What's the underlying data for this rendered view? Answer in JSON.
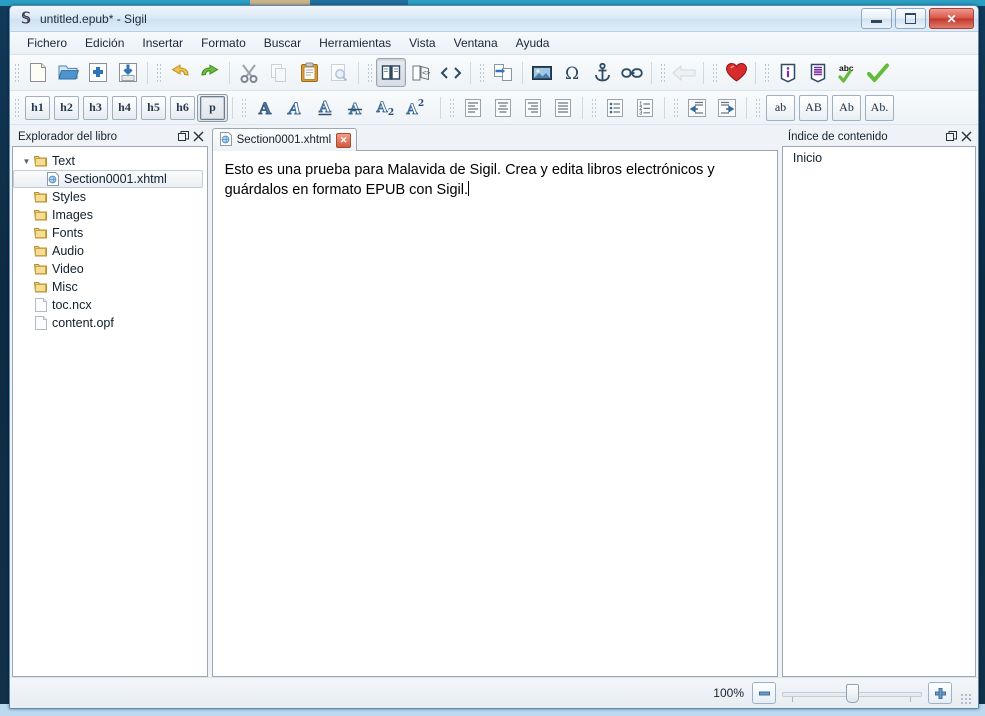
{
  "window": {
    "title": "untitled.epub* - Sigil",
    "app_icon": "sigil-s-icon",
    "minimize_label": "",
    "maximize_label": "",
    "close_label": "✕"
  },
  "menubar": {
    "items": [
      {
        "label": "Fichero",
        "name": "menu-fichero"
      },
      {
        "label": "Edición",
        "name": "menu-edicion"
      },
      {
        "label": "Insertar",
        "name": "menu-insertar"
      },
      {
        "label": "Formato",
        "name": "menu-formato"
      },
      {
        "label": "Buscar",
        "name": "menu-buscar"
      },
      {
        "label": "Herramientas",
        "name": "menu-herramientas"
      },
      {
        "label": "Vista",
        "name": "menu-vista"
      },
      {
        "label": "Ventana",
        "name": "menu-ventana"
      },
      {
        "label": "Ayuda",
        "name": "menu-ayuda"
      }
    ]
  },
  "toolbar_row1": {
    "groups": [
      [
        "new-file-icon",
        "open-folder-icon",
        "add-file-icon",
        "save-icon"
      ],
      [
        "undo-icon",
        "redo-icon"
      ],
      [
        "cut-scissors-icon",
        "copy-icon",
        "paste-clipboard-icon",
        "print-preview-icon"
      ],
      [
        "book-view-icon",
        "split-view-icon",
        "code-view-icon"
      ],
      [
        "split-section-icon"
      ],
      [
        "insert-image-icon",
        "insert-special-character-icon",
        "insert-anchor-icon",
        "insert-link-icon"
      ],
      [
        "back-arrow-icon"
      ],
      [
        "heart-donate-icon"
      ],
      [
        "metadata-info-icon",
        "generate-toc-icon",
        "spellcheck-icon",
        "validate-check-icon"
      ]
    ]
  },
  "toolbar_row2": {
    "headings": [
      "h1",
      "h2",
      "h3",
      "h4",
      "h5",
      "h6",
      "p"
    ],
    "selected_heading": "p",
    "format_icons": [
      "bold-icon",
      "italic-icon",
      "underline-icon",
      "strikethrough-icon",
      "subscript-icon",
      "superscript-icon"
    ],
    "align_icons": [
      "align-left-icon",
      "align-center-icon",
      "align-right-icon",
      "align-justify-icon"
    ],
    "list_icons": [
      "bullet-list-icon",
      "numbered-list-icon"
    ],
    "indent_icons": [
      "decrease-indent-icon",
      "increase-indent-icon"
    ],
    "case_buttons": [
      "ab",
      "AB",
      "Ab",
      "Ab."
    ]
  },
  "left_panel": {
    "title": "Explorador del libro",
    "float_icon": "undock-icon",
    "close_icon": "close-icon",
    "tree": [
      {
        "label": "Text",
        "type": "folder",
        "expanded": true,
        "indent": 0,
        "selected": false
      },
      {
        "label": "Section0001.xhtml",
        "type": "xhtml",
        "expanded": false,
        "indent": 1,
        "selected": true
      },
      {
        "label": "Styles",
        "type": "folder",
        "expanded": false,
        "indent": 0,
        "selected": false
      },
      {
        "label": "Images",
        "type": "folder",
        "expanded": false,
        "indent": 0,
        "selected": false
      },
      {
        "label": "Fonts",
        "type": "folder",
        "expanded": false,
        "indent": 0,
        "selected": false
      },
      {
        "label": "Audio",
        "type": "folder",
        "expanded": false,
        "indent": 0,
        "selected": false
      },
      {
        "label": "Video",
        "type": "folder",
        "expanded": false,
        "indent": 0,
        "selected": false
      },
      {
        "label": "Misc",
        "type": "folder",
        "expanded": false,
        "indent": 0,
        "selected": false
      },
      {
        "label": "toc.ncx",
        "type": "file",
        "expanded": false,
        "indent": 0,
        "selected": false
      },
      {
        "label": "content.opf",
        "type": "file",
        "expanded": false,
        "indent": 0,
        "selected": false
      }
    ]
  },
  "editor": {
    "tab_label": "Section0001.xhtml",
    "tab_icon": "xhtml-file-icon",
    "tab_close": "✕",
    "content": "Esto es una prueba para Malavida de Sigil. Crea y edita libros electrónicos y guárdalos en formato EPUB con Sigil."
  },
  "right_panel": {
    "title": "Índice de contenido",
    "float_icon": "undock-icon",
    "close_icon": "close-icon",
    "items": [
      {
        "label": "Inicio"
      }
    ]
  },
  "statusbar": {
    "zoom_level": "100%",
    "zoom_out_label": "−",
    "zoom_in_label": "+",
    "slider_value": 50
  },
  "colors": {
    "accent": "#3a6ea5",
    "window_border": "#5c8bb5",
    "close_red": "#c0392c",
    "icon_blue": "#3e6c98",
    "folder_yellow": "#e8c96a"
  }
}
